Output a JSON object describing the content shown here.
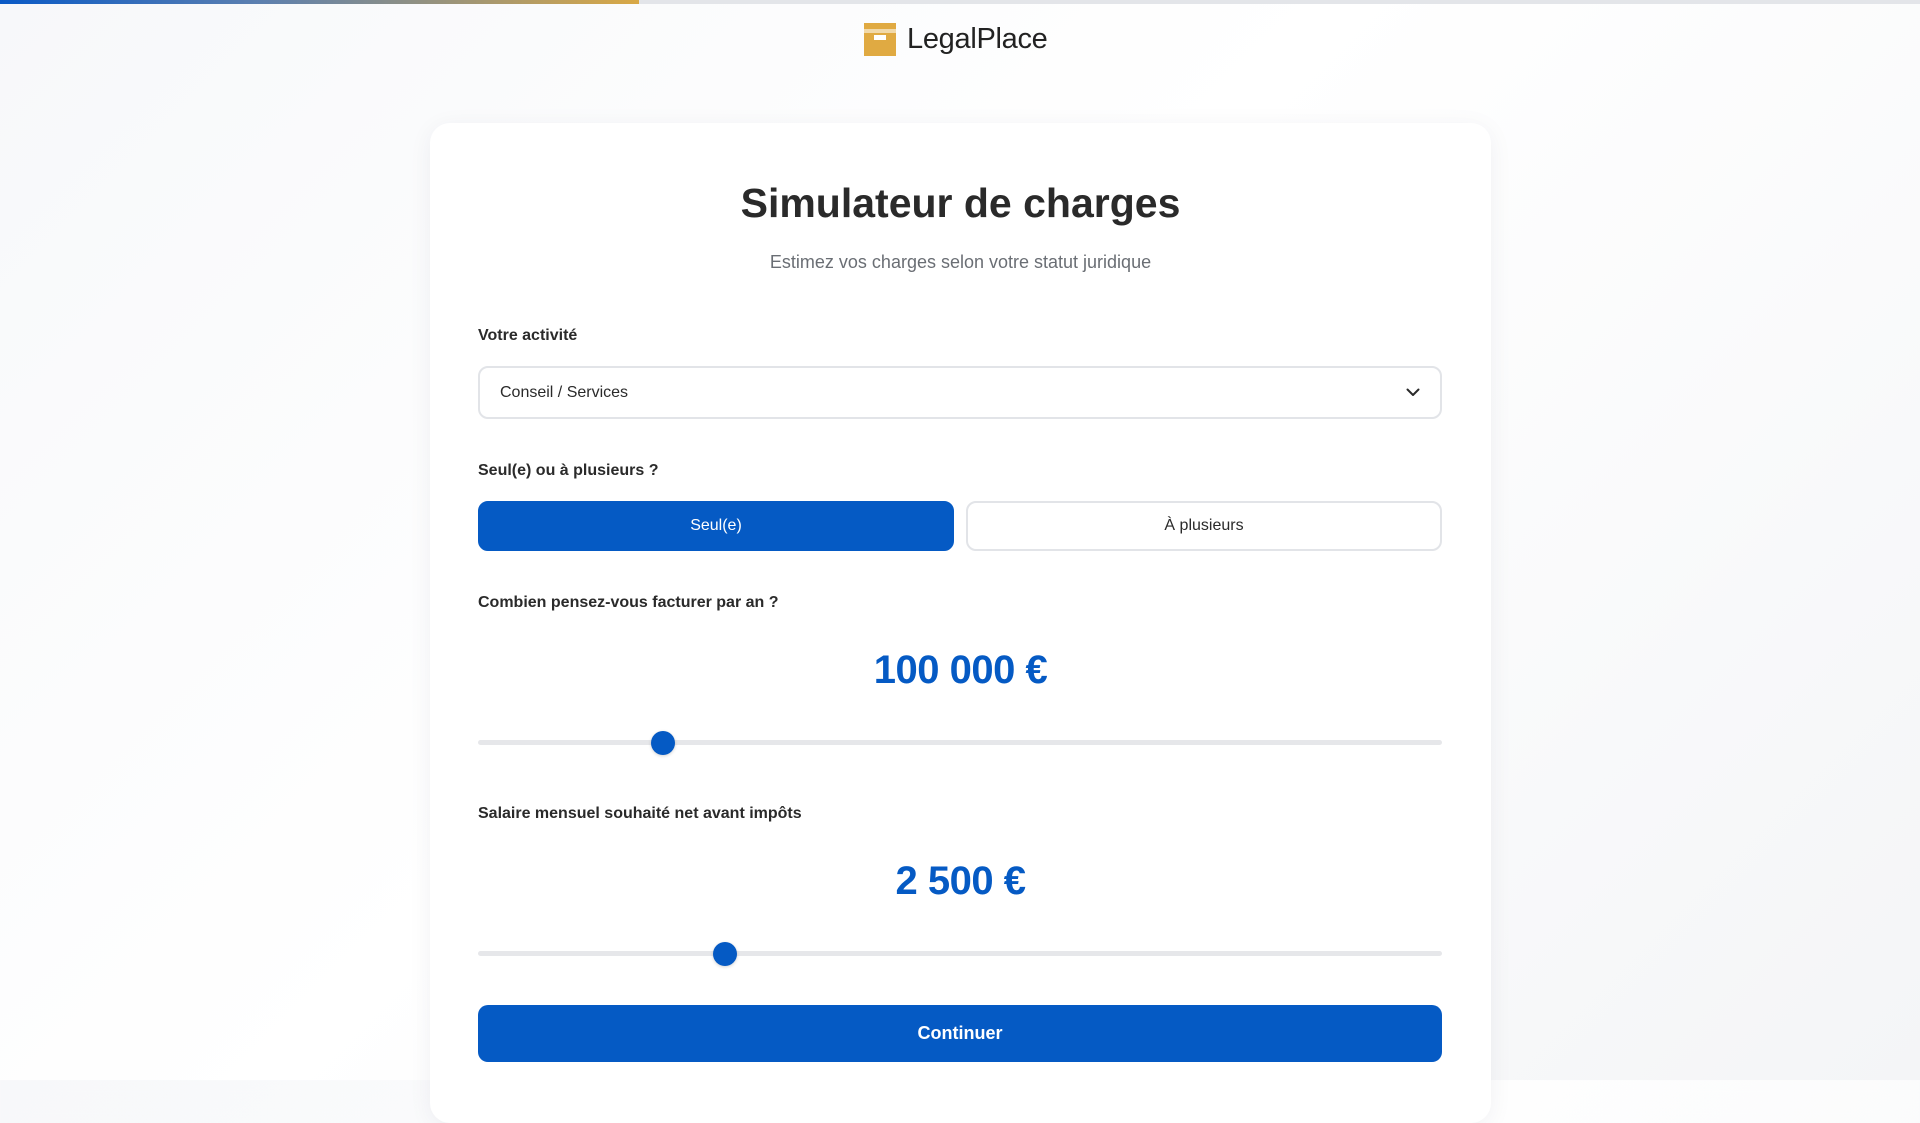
{
  "progress": {
    "fraction": 0.333
  },
  "brand": {
    "name": "LegalPlace",
    "icon": "legalplace-logo-icon",
    "colors": {
      "logo": "#e0aa42",
      "accent": "#055ac4"
    }
  },
  "header": {
    "title": "Simulateur de charges",
    "subtitle": "Estimez vos charges selon votre statut juridique"
  },
  "activity": {
    "label": "Votre activité",
    "selected": "Conseil / Services",
    "icon": "chevron-down-icon"
  },
  "partners": {
    "label": "Seul(e) ou à plusieurs ?",
    "options": [
      "Seul(e)",
      "À plusieurs"
    ],
    "selected": "Seul(e)"
  },
  "revenue": {
    "label": "Combien pensez-vous facturer par an ?",
    "display": "100 000 €",
    "value": 100000,
    "slider_fraction": 0.192
  },
  "salary": {
    "label": "Salaire mensuel souhaité net avant impôts",
    "display": "2 500 €",
    "value": 2500,
    "slider_fraction": 0.256
  },
  "actions": {
    "continue_label": "Continuer"
  }
}
